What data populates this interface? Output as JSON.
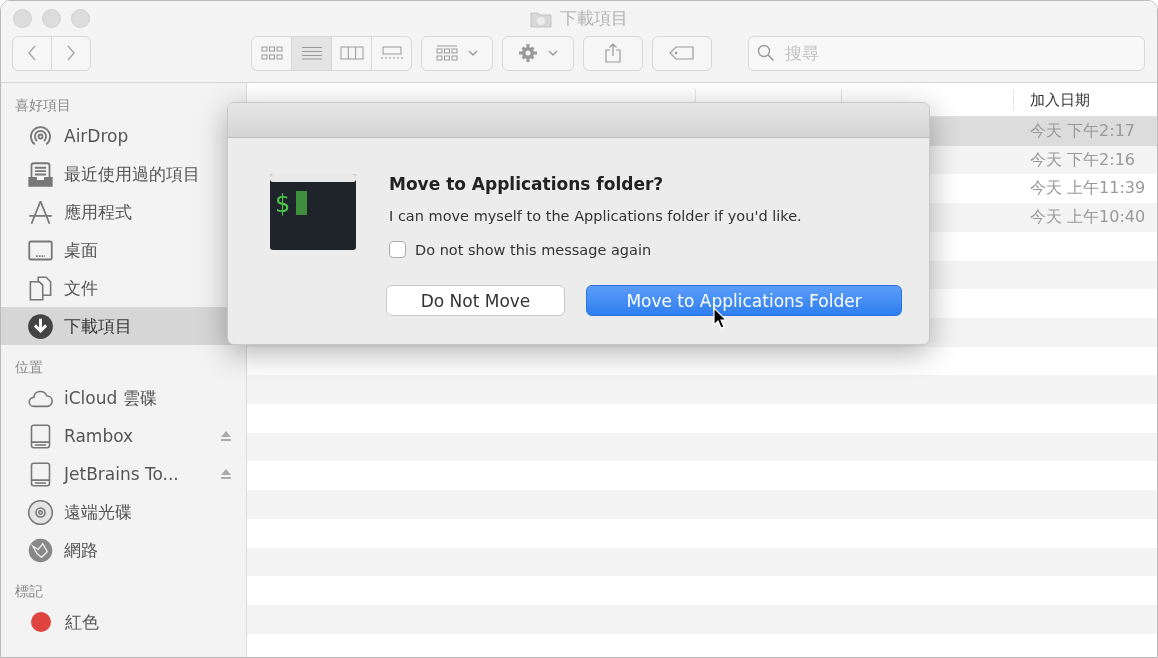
{
  "window": {
    "title": "下載項目"
  },
  "toolbar": {
    "view_modes": [
      {
        "kind": "icons",
        "selected": false
      },
      {
        "kind": "list",
        "selected": true
      },
      {
        "kind": "columns",
        "selected": false
      },
      {
        "kind": "gallery",
        "selected": false
      }
    ],
    "search": {
      "placeholder": "搜尋"
    }
  },
  "sidebar": {
    "sections": [
      {
        "heading": "喜好項目",
        "items": [
          {
            "label": "AirDrop",
            "kind": "airdrop",
            "selected": false
          },
          {
            "label": "最近使用過的項目",
            "kind": "recents",
            "selected": false
          },
          {
            "label": "應用程式",
            "kind": "apps",
            "selected": false
          },
          {
            "label": "桌面",
            "kind": "desktop",
            "selected": false
          },
          {
            "label": "文件",
            "kind": "documents",
            "selected": false
          },
          {
            "label": "下載項目",
            "kind": "downloads",
            "selected": true
          }
        ]
      },
      {
        "heading": "位置",
        "items": [
          {
            "label": "iCloud 雲碟",
            "kind": "cloud",
            "selected": false
          },
          {
            "label": "Rambox",
            "kind": "disk",
            "selected": false,
            "ejectable": true
          },
          {
            "label": "JetBrains To...",
            "kind": "disk",
            "selected": false,
            "ejectable": true
          },
          {
            "label": "遠端光碟",
            "kind": "disc",
            "selected": false
          },
          {
            "label": "網路",
            "kind": "network",
            "selected": false
          }
        ]
      },
      {
        "heading": "標記",
        "items": [
          {
            "label": "紅色",
            "kind": "tag",
            "color": "#e0443e",
            "selected": false
          }
        ]
      }
    ]
  },
  "table": {
    "columns": [
      "加入日期"
    ],
    "rows": [
      {
        "date_added": "今天 下午2:17",
        "selected": true
      },
      {
        "date_added": "今天 下午2:16",
        "selected": false
      },
      {
        "date_added": "今天 上午11:39",
        "selected": false
      },
      {
        "date_added": "今天 上午10:40",
        "selected": false
      }
    ]
  },
  "dialog": {
    "icon_prompt": "$",
    "title": "Move to Applications folder?",
    "message": "I can move myself to the Applications folder if you'd like.",
    "checkbox": {
      "label": "Do not show this message again",
      "checked": false
    },
    "buttons": [
      {
        "label": "Do Not Move",
        "kind": "secondary"
      },
      {
        "label": "Move to Applications Folder",
        "kind": "default"
      }
    ]
  }
}
